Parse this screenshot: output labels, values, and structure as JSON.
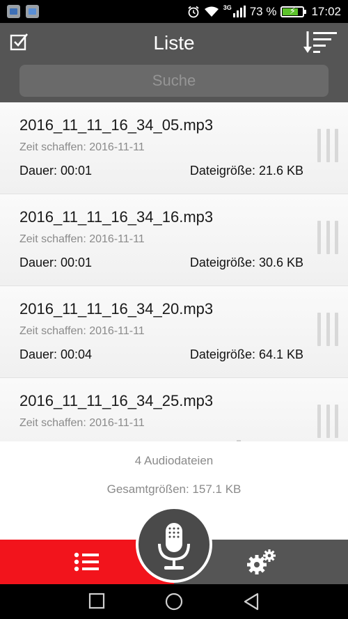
{
  "status_bar": {
    "network_type": "3G",
    "battery_percent_text": "73 %",
    "battery_level": 0.73,
    "time": "17:02",
    "icons": [
      "app-notification-icon",
      "gallery-notification-icon",
      "alarm-icon",
      "wifi-icon",
      "signal-icon",
      "battery-charging-icon"
    ]
  },
  "header": {
    "title": "Liste",
    "search_placeholder": "Suche"
  },
  "recordings": [
    {
      "filename": "2016_11_11_16_34_05.mp3",
      "created": "Zeit schaffen: 2016-11-11",
      "duration": "Dauer: 00:01",
      "size": "Dateigröße: 21.6 KB"
    },
    {
      "filename": "2016_11_11_16_34_16.mp3",
      "created": "Zeit schaffen: 2016-11-11",
      "duration": "Dauer: 00:01",
      "size": "Dateigröße: 30.6 KB"
    },
    {
      "filename": "2016_11_11_16_34_20.mp3",
      "created": "Zeit schaffen: 2016-11-11",
      "duration": "Dauer: 00:04",
      "size": "Dateigröße: 64.1 KB"
    },
    {
      "filename": "2016_11_11_16_34_25.mp3",
      "created": "Zeit schaffen: 2016-11-11",
      "duration": "",
      "size": ""
    }
  ],
  "summary": {
    "count": "4 Audiodateien",
    "total": "Gesamtgrößen: 157.1 KB"
  },
  "colors": {
    "accent": "#f2141c",
    "header_bg": "#555555",
    "bar_bg": "#000000"
  }
}
